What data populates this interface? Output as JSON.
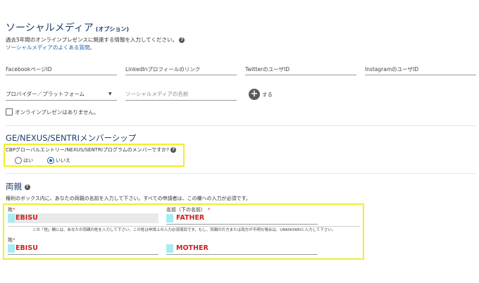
{
  "social": {
    "title": "ソーシャルメディア",
    "optional": "(オプション)",
    "description": "過去5年間のオンラインプレゼンスに関連する情報を入力してください。",
    "faq_link": "ソーシャルメディアのよくある質問。",
    "fields": {
      "facebook": "FacebookページID",
      "linkedin": "LinkedInプロフィールのリンク",
      "twitter": "TwitterのユーザID",
      "instagram": "InstagramのユーザID"
    },
    "provider_select": "プロバイダー／プラットフォーム",
    "name_placeholder": "ソーシャルメディアの名前",
    "add_label": "する",
    "no_presence": "オンラインプレゼンはありません。"
  },
  "membership": {
    "title": "GE/NEXUS/SENTRIメンバーシップ",
    "question": "CBPグローバルエントリー/NEXUS/SENTRIプログラムのメンバーですか?",
    "options": [
      {
        "label": "はい",
        "selected": false
      },
      {
        "label": "いいえ",
        "selected": true
      }
    ]
  },
  "parents": {
    "title": "両親",
    "instruction": "権利のボックス内に、あなたの両親の名前を入力して下さい。すべての申請者は、この欄への入力が必須です。",
    "surname_label": "姓",
    "given_label": "名前（下の名前）",
    "required_mark": "*",
    "note": "この「姓」欄には、あなたの両親の姓を入力して下さい。この姓は申請上の入力必須項目です。もし、両親の片方または両方が不明な場合は、UNKNOWNと入力して下さい。",
    "father": {
      "surname": "EBISU",
      "given": "FATHER"
    },
    "mother": {
      "surname": "EBISU",
      "given": "MOTHER"
    }
  },
  "help_icon": "?",
  "colors": {
    "heading": "#1f3f6a",
    "link": "#1a5fa8",
    "highlight_box": "#f1ee2a",
    "field_highlight": "#a7ecf2",
    "value_text": "#cc2222"
  }
}
